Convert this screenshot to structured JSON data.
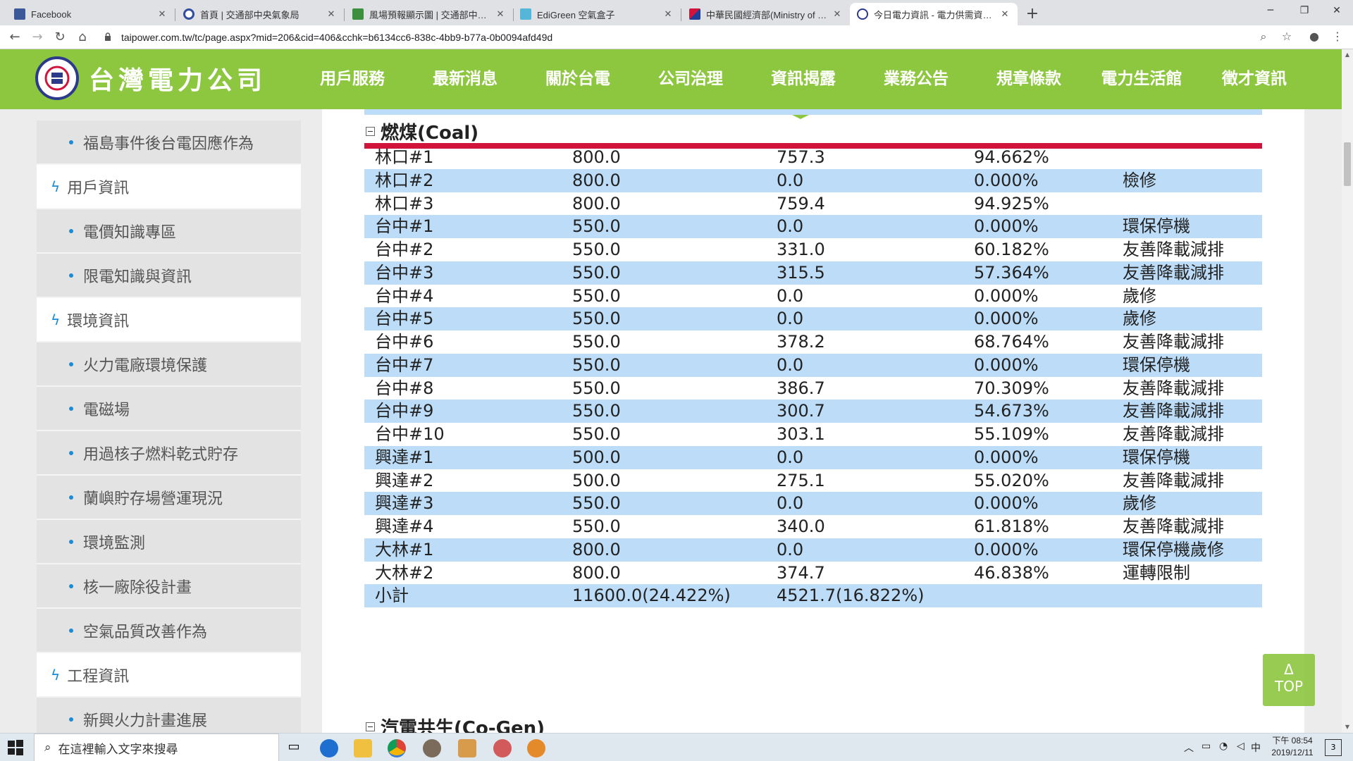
{
  "browser": {
    "tabs": [
      {
        "title": "Facebook"
      },
      {
        "title": "首頁 | 交通部中央氣象局"
      },
      {
        "title": "風場預報顯示圖 | 交通部中央氣"
      },
      {
        "title": "EdiGreen 空氣盒子"
      },
      {
        "title": "中華民國經濟部(Ministry of Eco"
      },
      {
        "title": "今日電力資訊 - 電力供需資訊 - 台"
      }
    ],
    "url": "taipower.com.tw/tc/page.aspx?mid=206&cid=406&cchk=b6134cc6-838c-4bb9-b77a-0b0094afd49d"
  },
  "site": {
    "logo_text": "台灣電力公司",
    "nav": [
      "用戶服務",
      "最新消息",
      "關於台電",
      "公司治理",
      "資訊揭露",
      "業務公告",
      "規章條款",
      "電力生活館",
      "徵才資訊"
    ],
    "accent_color": "#8dc63f"
  },
  "sidebar": {
    "items": [
      "福島事件後台電因應作為",
      "用戶資訊",
      "電價知識專區",
      "限電知識與資訊",
      "環境資訊",
      "火力電廠環境保護",
      "電磁場",
      "用過核子燃料乾式貯存",
      "蘭嶼貯存場營運現況",
      "環境監測",
      "核一廠除役計畫",
      "空氣品質改善作為",
      "工程資訊",
      "新興火力計畫進展"
    ]
  },
  "table": {
    "section_title": "燃煤(Coal)",
    "next_section_title": "汽電共生(Co-Gen)",
    "divider_color": "#d0143c",
    "alt_row_color": "#bcdcf7",
    "rows": [
      [
        "林口#1",
        "800.0",
        "757.3",
        "94.662%",
        ""
      ],
      [
        "林口#2",
        "800.0",
        "0.0",
        "0.000%",
        "檢修"
      ],
      [
        "林口#3",
        "800.0",
        "759.4",
        "94.925%",
        ""
      ],
      [
        "台中#1",
        "550.0",
        "0.0",
        "0.000%",
        "環保停機"
      ],
      [
        "台中#2",
        "550.0",
        "331.0",
        "60.182%",
        "友善降載減排"
      ],
      [
        "台中#3",
        "550.0",
        "315.5",
        "57.364%",
        "友善降載減排"
      ],
      [
        "台中#4",
        "550.0",
        "0.0",
        "0.000%",
        "歲修"
      ],
      [
        "台中#5",
        "550.0",
        "0.0",
        "0.000%",
        "歲修"
      ],
      [
        "台中#6",
        "550.0",
        "378.2",
        "68.764%",
        "友善降載減排"
      ],
      [
        "台中#7",
        "550.0",
        "0.0",
        "0.000%",
        "環保停機"
      ],
      [
        "台中#8",
        "550.0",
        "386.7",
        "70.309%",
        "友善降載減排"
      ],
      [
        "台中#9",
        "550.0",
        "300.7",
        "54.673%",
        "友善降載減排"
      ],
      [
        "台中#10",
        "550.0",
        "303.1",
        "55.109%",
        "友善降載減排"
      ],
      [
        "興達#1",
        "500.0",
        "0.0",
        "0.000%",
        "環保停機"
      ],
      [
        "興達#2",
        "500.0",
        "275.1",
        "55.020%",
        "友善降載減排"
      ],
      [
        "興達#3",
        "550.0",
        "0.0",
        "0.000%",
        "歲修"
      ],
      [
        "興達#4",
        "550.0",
        "340.0",
        "61.818%",
        "友善降載減排"
      ],
      [
        "大林#1",
        "800.0",
        "0.0",
        "0.000%",
        "環保停機歲修"
      ],
      [
        "大林#2",
        "800.0",
        "374.7",
        "46.838%",
        "運轉限制"
      ],
      [
        "小計",
        "11600.0(24.422%)",
        "4521.7(16.822%)",
        "",
        ""
      ]
    ]
  },
  "page": {
    "top_label": "TOP"
  },
  "taskbar": {
    "search_placeholder": "在這裡輸入文字來搜尋",
    "ime": "中",
    "time": "下午 08:54",
    "date": "2019/12/11",
    "notifications": "3"
  }
}
